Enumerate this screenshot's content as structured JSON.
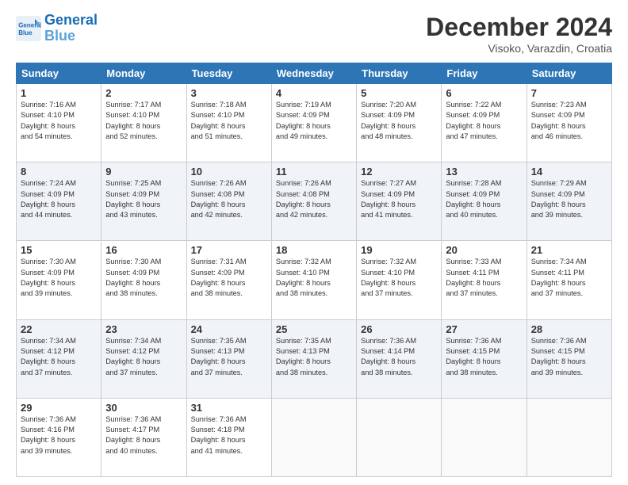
{
  "header": {
    "logo_line1": "General",
    "logo_line2": "Blue",
    "month": "December 2024",
    "location": "Visoko, Varazdin, Croatia"
  },
  "weekdays": [
    "Sunday",
    "Monday",
    "Tuesday",
    "Wednesday",
    "Thursday",
    "Friday",
    "Saturday"
  ],
  "weeks": [
    [
      {
        "day": "1",
        "info": "Sunrise: 7:16 AM\nSunset: 4:10 PM\nDaylight: 8 hours\nand 54 minutes."
      },
      {
        "day": "2",
        "info": "Sunrise: 7:17 AM\nSunset: 4:10 PM\nDaylight: 8 hours\nand 52 minutes."
      },
      {
        "day": "3",
        "info": "Sunrise: 7:18 AM\nSunset: 4:10 PM\nDaylight: 8 hours\nand 51 minutes."
      },
      {
        "day": "4",
        "info": "Sunrise: 7:19 AM\nSunset: 4:09 PM\nDaylight: 8 hours\nand 49 minutes."
      },
      {
        "day": "5",
        "info": "Sunrise: 7:20 AM\nSunset: 4:09 PM\nDaylight: 8 hours\nand 48 minutes."
      },
      {
        "day": "6",
        "info": "Sunrise: 7:22 AM\nSunset: 4:09 PM\nDaylight: 8 hours\nand 47 minutes."
      },
      {
        "day": "7",
        "info": "Sunrise: 7:23 AM\nSunset: 4:09 PM\nDaylight: 8 hours\nand 46 minutes."
      }
    ],
    [
      {
        "day": "8",
        "info": "Sunrise: 7:24 AM\nSunset: 4:09 PM\nDaylight: 8 hours\nand 44 minutes."
      },
      {
        "day": "9",
        "info": "Sunrise: 7:25 AM\nSunset: 4:09 PM\nDaylight: 8 hours\nand 43 minutes."
      },
      {
        "day": "10",
        "info": "Sunrise: 7:26 AM\nSunset: 4:08 PM\nDaylight: 8 hours\nand 42 minutes."
      },
      {
        "day": "11",
        "info": "Sunrise: 7:26 AM\nSunset: 4:08 PM\nDaylight: 8 hours\nand 42 minutes."
      },
      {
        "day": "12",
        "info": "Sunrise: 7:27 AM\nSunset: 4:09 PM\nDaylight: 8 hours\nand 41 minutes."
      },
      {
        "day": "13",
        "info": "Sunrise: 7:28 AM\nSunset: 4:09 PM\nDaylight: 8 hours\nand 40 minutes."
      },
      {
        "day": "14",
        "info": "Sunrise: 7:29 AM\nSunset: 4:09 PM\nDaylight: 8 hours\nand 39 minutes."
      }
    ],
    [
      {
        "day": "15",
        "info": "Sunrise: 7:30 AM\nSunset: 4:09 PM\nDaylight: 8 hours\nand 39 minutes."
      },
      {
        "day": "16",
        "info": "Sunrise: 7:30 AM\nSunset: 4:09 PM\nDaylight: 8 hours\nand 38 minutes."
      },
      {
        "day": "17",
        "info": "Sunrise: 7:31 AM\nSunset: 4:09 PM\nDaylight: 8 hours\nand 38 minutes."
      },
      {
        "day": "18",
        "info": "Sunrise: 7:32 AM\nSunset: 4:10 PM\nDaylight: 8 hours\nand 38 minutes."
      },
      {
        "day": "19",
        "info": "Sunrise: 7:32 AM\nSunset: 4:10 PM\nDaylight: 8 hours\nand 37 minutes."
      },
      {
        "day": "20",
        "info": "Sunrise: 7:33 AM\nSunset: 4:11 PM\nDaylight: 8 hours\nand 37 minutes."
      },
      {
        "day": "21",
        "info": "Sunrise: 7:34 AM\nSunset: 4:11 PM\nDaylight: 8 hours\nand 37 minutes."
      }
    ],
    [
      {
        "day": "22",
        "info": "Sunrise: 7:34 AM\nSunset: 4:12 PM\nDaylight: 8 hours\nand 37 minutes."
      },
      {
        "day": "23",
        "info": "Sunrise: 7:34 AM\nSunset: 4:12 PM\nDaylight: 8 hours\nand 37 minutes."
      },
      {
        "day": "24",
        "info": "Sunrise: 7:35 AM\nSunset: 4:13 PM\nDaylight: 8 hours\nand 37 minutes."
      },
      {
        "day": "25",
        "info": "Sunrise: 7:35 AM\nSunset: 4:13 PM\nDaylight: 8 hours\nand 38 minutes."
      },
      {
        "day": "26",
        "info": "Sunrise: 7:36 AM\nSunset: 4:14 PM\nDaylight: 8 hours\nand 38 minutes."
      },
      {
        "day": "27",
        "info": "Sunrise: 7:36 AM\nSunset: 4:15 PM\nDaylight: 8 hours\nand 38 minutes."
      },
      {
        "day": "28",
        "info": "Sunrise: 7:36 AM\nSunset: 4:15 PM\nDaylight: 8 hours\nand 39 minutes."
      }
    ],
    [
      {
        "day": "29",
        "info": "Sunrise: 7:36 AM\nSunset: 4:16 PM\nDaylight: 8 hours\nand 39 minutes."
      },
      {
        "day": "30",
        "info": "Sunrise: 7:36 AM\nSunset: 4:17 PM\nDaylight: 8 hours\nand 40 minutes."
      },
      {
        "day": "31",
        "info": "Sunrise: 7:36 AM\nSunset: 4:18 PM\nDaylight: 8 hours\nand 41 minutes."
      },
      {
        "day": "",
        "info": ""
      },
      {
        "day": "",
        "info": ""
      },
      {
        "day": "",
        "info": ""
      },
      {
        "day": "",
        "info": ""
      }
    ]
  ]
}
